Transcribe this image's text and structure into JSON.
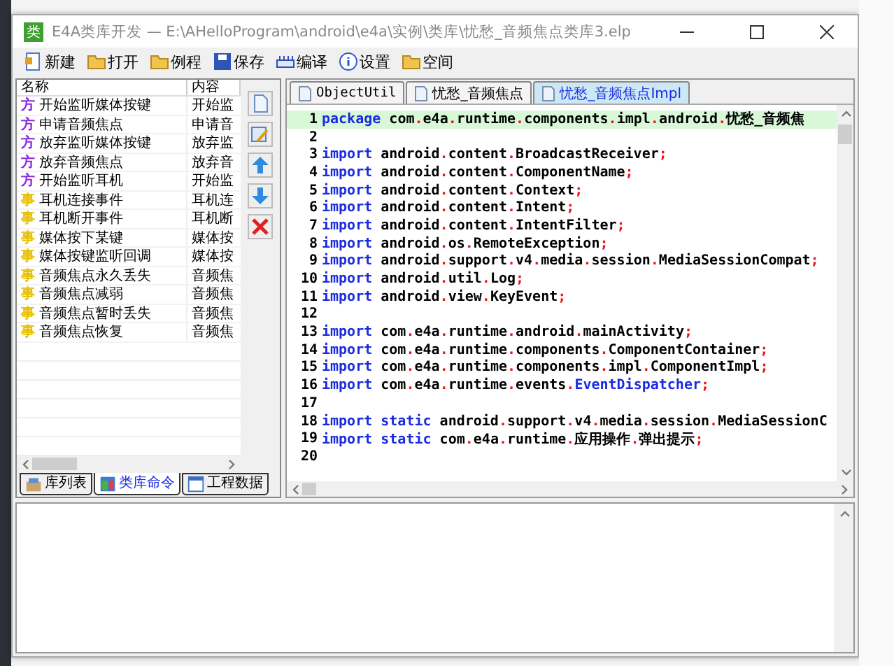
{
  "window": {
    "app_icon_glyph": "类",
    "title": "E4A类库开发 — E:\\AHelloProgram\\android\\e4a\\实例\\类库\\忧愁_音频焦点类库3.elp"
  },
  "toolbar": [
    "新建",
    "打开",
    "例程",
    "保存",
    "编译",
    "设置",
    "空间"
  ],
  "command_list": {
    "columns": [
      "名称",
      "内容"
    ],
    "rows": [
      {
        "tag": "方",
        "kind": "method",
        "name": "开始监听媒体按键",
        "content": "开始监"
      },
      {
        "tag": "方",
        "kind": "method",
        "name": "申请音频焦点",
        "content": "申请音"
      },
      {
        "tag": "方",
        "kind": "method",
        "name": "放弃监听媒体按键",
        "content": "放弃监"
      },
      {
        "tag": "方",
        "kind": "method",
        "name": "放弃音频焦点",
        "content": "放弃音"
      },
      {
        "tag": "方",
        "kind": "method",
        "name": "开始监听耳机",
        "content": "开始监"
      },
      {
        "tag": "事",
        "kind": "event",
        "name": "耳机连接事件",
        "content": "耳机连"
      },
      {
        "tag": "事",
        "kind": "event",
        "name": "耳机断开事件",
        "content": "耳机断"
      },
      {
        "tag": "事",
        "kind": "event",
        "name": "媒体按下某键",
        "content": "媒体按"
      },
      {
        "tag": "事",
        "kind": "event",
        "name": "媒体按键监听回调",
        "content": "媒体按"
      },
      {
        "tag": "事",
        "kind": "event",
        "name": "音频焦点永久丢失",
        "content": "音频焦"
      },
      {
        "tag": "事",
        "kind": "event",
        "name": "音频焦点减弱",
        "content": "音频焦"
      },
      {
        "tag": "事",
        "kind": "event",
        "name": "音频焦点暂时丢失",
        "content": "音频焦"
      },
      {
        "tag": "事",
        "kind": "event",
        "name": "音频焦点恢复",
        "content": "音频焦"
      }
    ]
  },
  "left_tabs": [
    {
      "label": "库列表",
      "selected": false
    },
    {
      "label": "类库命令",
      "selected": true
    },
    {
      "label": "工程数据",
      "selected": false
    }
  ],
  "editor_tabs": [
    {
      "label": "ObjectUtil",
      "selected": false
    },
    {
      "label": "忧愁_音频焦点",
      "selected": false
    },
    {
      "label": "忧愁_音频焦点Impl",
      "selected": true
    }
  ],
  "code_lines": [
    {
      "number": "1",
      "highlighted": true,
      "segments": [
        {
          "text": "package",
          "kind": "keyword"
        },
        {
          "text": " com.e4a.runtime.components.impl.android.忧愁_音频焦",
          "kind": "plain"
        }
      ]
    },
    {
      "number": "2",
      "highlighted": false
    },
    {
      "number": "3",
      "highlighted": false,
      "segments": [
        {
          "text": "import",
          "kind": "keyword"
        },
        {
          "text": " android.content.BroadcastReceiver;",
          "kind": "plain"
        }
      ]
    },
    {
      "number": "4",
      "highlighted": false,
      "segments": [
        {
          "text": "import",
          "kind": "keyword"
        },
        {
          "text": " android.content.ComponentName;",
          "kind": "plain"
        }
      ]
    },
    {
      "number": "5",
      "highlighted": false,
      "segments": [
        {
          "text": "import",
          "kind": "keyword"
        },
        {
          "text": " android.content.Context;",
          "kind": "plain"
        }
      ]
    },
    {
      "number": "6",
      "highlighted": false,
      "segments": [
        {
          "text": "import",
          "kind": "keyword"
        },
        {
          "text": " android.content.Intent;",
          "kind": "plain"
        }
      ]
    },
    {
      "number": "7",
      "highlighted": false,
      "segments": [
        {
          "text": "import",
          "kind": "keyword"
        },
        {
          "text": " android.content.IntentFilter;",
          "kind": "plain"
        }
      ]
    },
    {
      "number": "8",
      "highlighted": false,
      "segments": [
        {
          "text": "import",
          "kind": "keyword"
        },
        {
          "text": " android.os.RemoteException;",
          "kind": "plain"
        }
      ]
    },
    {
      "number": "9",
      "highlighted": false,
      "segments": [
        {
          "text": "import",
          "kind": "keyword"
        },
        {
          "text": " android.support.v4.media.session.MediaSessionCompat;",
          "kind": "plain"
        }
      ]
    },
    {
      "number": "10",
      "highlighted": false,
      "segments": [
        {
          "text": "import",
          "kind": "keyword"
        },
        {
          "text": " android.util.Log;",
          "kind": "plain"
        }
      ]
    },
    {
      "number": "11",
      "highlighted": false,
      "segments": [
        {
          "text": "import",
          "kind": "keyword"
        },
        {
          "text": " android.view.KeyEvent;",
          "kind": "plain"
        }
      ]
    },
    {
      "number": "12",
      "highlighted": false
    },
    {
      "number": "13",
      "highlighted": false,
      "segments": [
        {
          "text": "import",
          "kind": "keyword"
        },
        {
          "text": " com.e4a.runtime.android.mainActivity;",
          "kind": "plain"
        }
      ]
    },
    {
      "number": "14",
      "highlighted": false,
      "segments": [
        {
          "text": "import",
          "kind": "keyword"
        },
        {
          "text": " com.e4a.runtime.components.ComponentContainer;",
          "kind": "plain"
        }
      ]
    },
    {
      "number": "15",
      "highlighted": false,
      "segments": [
        {
          "text": "import",
          "kind": "keyword"
        },
        {
          "text": " com.e4a.runtime.components.impl.ComponentImpl;",
          "kind": "plain"
        }
      ]
    },
    {
      "number": "16",
      "highlighted": false,
      "segments": [
        {
          "text": "import",
          "kind": "keyword"
        },
        {
          "text": " com.e4a.runtime.events.",
          "kind": "plain"
        },
        {
          "text": "EventDispatcher",
          "kind": "type"
        },
        {
          "text": ";",
          "kind": "plain"
        }
      ]
    },
    {
      "number": "17",
      "highlighted": false
    },
    {
      "number": "18",
      "highlighted": false,
      "segments": [
        {
          "text": "import static",
          "kind": "keyword"
        },
        {
          "text": " android.support.v4.media.session.MediaSessionC",
          "kind": "plain"
        }
      ]
    },
    {
      "number": "19",
      "highlighted": false,
      "segments": [
        {
          "text": "import static",
          "kind": "keyword"
        },
        {
          "text": " com.e4a.runtime.应用操作.弹出提示;",
          "kind": "plain"
        }
      ]
    },
    {
      "number": "20",
      "highlighted": false
    }
  ]
}
